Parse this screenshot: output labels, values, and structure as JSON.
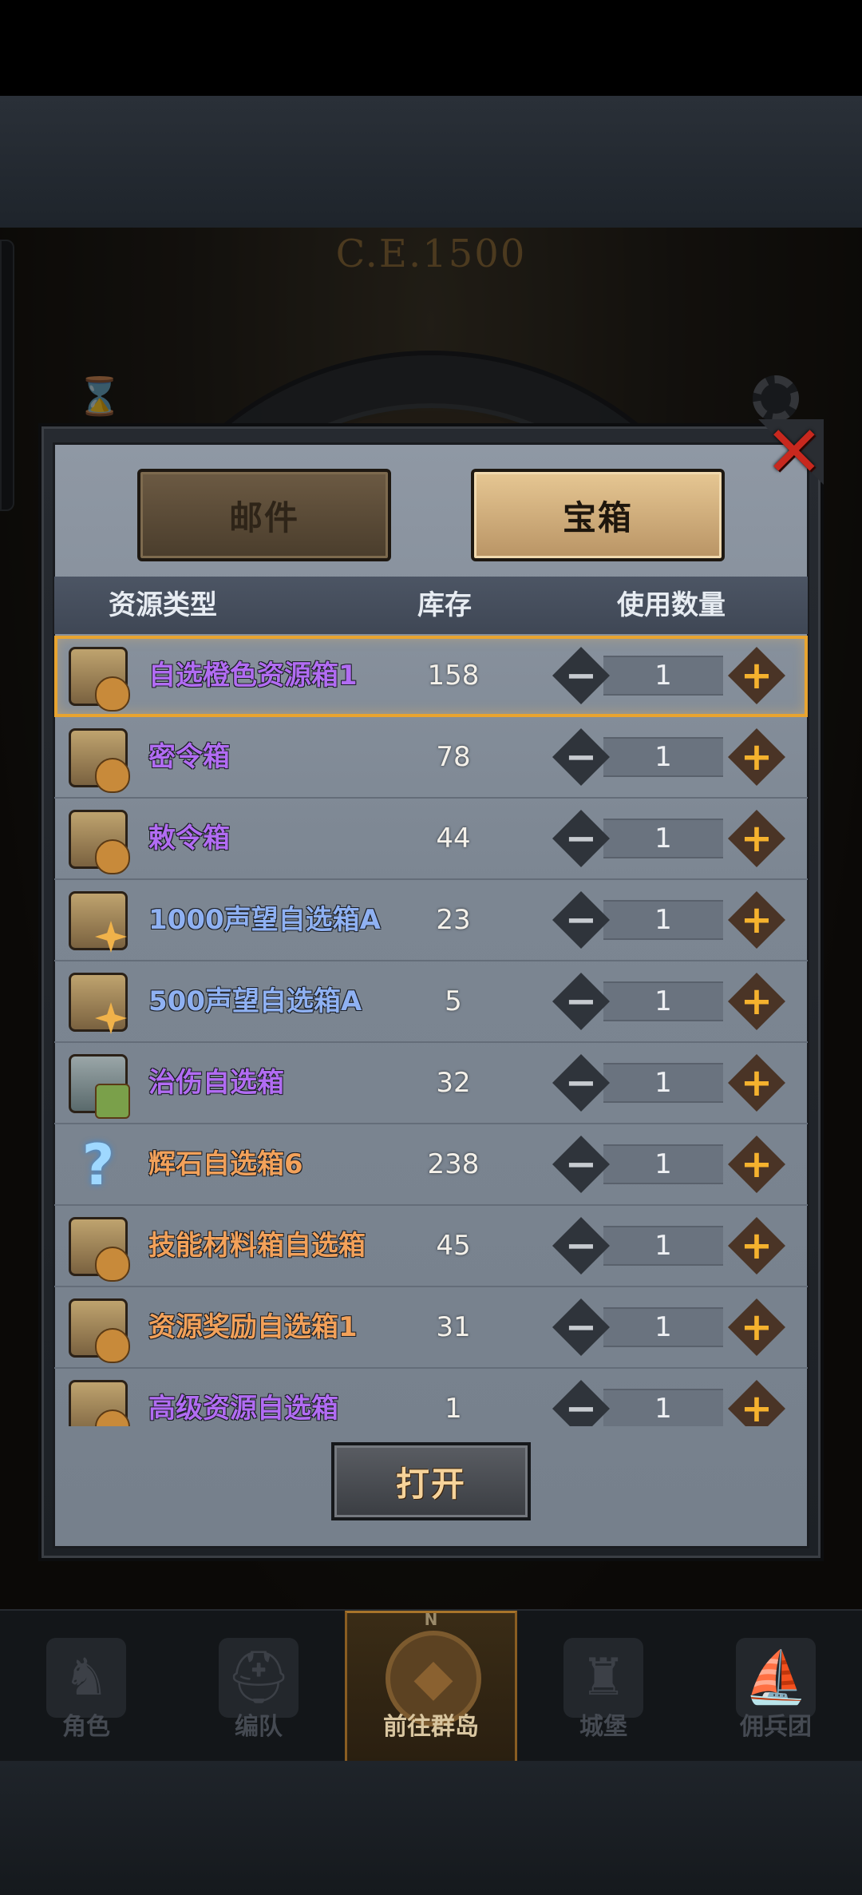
{
  "scene": {
    "era_label": "C.E.1500"
  },
  "modal": {
    "tabs": [
      {
        "label": "邮件",
        "active": false
      },
      {
        "label": "宝箱",
        "active": true
      }
    ],
    "columns": {
      "type": "资源类型",
      "stock": "库存",
      "use_count": "使用数量"
    },
    "items": [
      {
        "name": "自选橙色资源箱1",
        "stock": "158",
        "count": "1",
        "name_color": "#b16cf2",
        "icon": "chest-bag-icon",
        "selected": true
      },
      {
        "name": "密令箱",
        "stock": "78",
        "count": "1",
        "name_color": "#b16cf2",
        "icon": "chest-bag-icon"
      },
      {
        "name": "敕令箱",
        "stock": "44",
        "count": "1",
        "name_color": "#b16cf2",
        "icon": "chest-bag-icon"
      },
      {
        "name": "1000声望自选箱A",
        "stock": "23",
        "count": "1",
        "name_color": "#8fb1f2",
        "icon": "chest-star-icon"
      },
      {
        "name": "500声望自选箱A",
        "stock": "5",
        "count": "1",
        "name_color": "#8fb1f2",
        "icon": "chest-star-icon"
      },
      {
        "name": "治伤自选箱",
        "stock": "32",
        "count": "1",
        "name_color": "#b16cf2",
        "icon": "potion-icon"
      },
      {
        "name": "辉石自选箱6",
        "stock": "238",
        "count": "1",
        "name_color": "#f2a15a",
        "icon": "question-icon"
      },
      {
        "name": "技能材料箱自选箱",
        "stock": "45",
        "count": "1",
        "name_color": "#f2a15a",
        "icon": "chest-bag-icon"
      },
      {
        "name": "资源奖励自选箱1",
        "stock": "31",
        "count": "1",
        "name_color": "#f2a15a",
        "icon": "chest-bag-icon"
      },
      {
        "name": "高级资源自选箱",
        "stock": "1",
        "count": "1",
        "name_color": "#b16cf2",
        "icon": "chest-bag-icon"
      }
    ],
    "open_button": "打开",
    "close_icon": "close-icon"
  },
  "bottom_nav": [
    {
      "label": "角色",
      "icon": "knight-icon"
    },
    {
      "label": "编队",
      "icon": "helmet-icon"
    },
    {
      "label": "前往群岛",
      "icon": "compass-icon",
      "active": true,
      "compass_letter": "N"
    },
    {
      "label": "城堡",
      "icon": "castle-icon"
    },
    {
      "label": "佣兵团",
      "icon": "ship-icon"
    }
  ],
  "colors": {
    "accent": "#e8a430",
    "plus": "#f5b22e",
    "close": "#c8281e"
  }
}
